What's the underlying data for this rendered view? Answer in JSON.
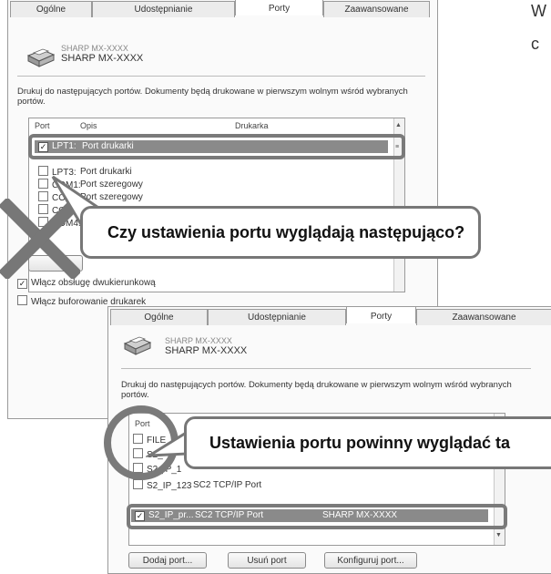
{
  "side_text": {
    "line1": "W",
    "line2": "c"
  },
  "top_dialog": {
    "tabs": [
      "Ogólne",
      "Udostępnianie",
      "Porty",
      "Zaawansowane"
    ],
    "printer_ghost": "SHARP MX-XXXX",
    "printer_name": "SHARP MX-XXXX",
    "description": "Drukuj do następujących portów. Dokumenty będą drukowane w pierwszym wolnym wśród wybranych portów.",
    "columns": [
      "Port",
      "Opis",
      "Drukarka"
    ],
    "selected_row": {
      "port": "LPT1:",
      "desc": "Port drukarki",
      "checked": true
    },
    "rows": [
      {
        "port": "LPT3:",
        "desc": "Port drukarki"
      },
      {
        "port": "COM1:",
        "desc": "Port szeregowy"
      },
      {
        "port": "COM2:",
        "desc": "Port szeregowy"
      },
      {
        "port": "COM3:",
        "desc": ""
      },
      {
        "port": "COM4:",
        "desc": ""
      }
    ],
    "bidi": "Włącz obsługę dwukierunkową",
    "pooling": "Włącz buforowanie drukarek"
  },
  "callout_top": "Czy ustawienia portu wyglądają następująco?",
  "bottom_dialog": {
    "tabs": [
      "Ogólne",
      "Udostępnianie",
      "Porty",
      "Zaawansowane"
    ],
    "printer_ghost": "SHARP MX-XXXX",
    "printer_name": "SHARP MX-XXXX",
    "description": "Drukuj do następujących portów. Dokumenty będą drukowane w pierwszym wolnym wśród wybranych portów.",
    "col_port": "Port",
    "rows": [
      {
        "port": "FILE",
        "desc": ""
      },
      {
        "port": "S2_",
        "desc": ""
      },
      {
        "port": "S2_IP_1",
        "desc": ""
      },
      {
        "port": "S2_IP_123",
        "desc": "SC2 TCP/IP Port"
      }
    ],
    "selected_row": {
      "port": "S2_IP_pr...",
      "desc": "SC2 TCP/IP Port",
      "printer": "SHARP MX-XXXX",
      "checked": true
    },
    "buttons": {
      "add": "Dodaj port...",
      "delete": "Usuń port",
      "configure": "Konfiguruj port..."
    }
  },
  "callout_bottom": "Ustawienia portu powinny wyglądać ta",
  "colors": {
    "highlight": "#8a8a8a",
    "frame": "#7a7a7a",
    "cross": "#777777"
  }
}
